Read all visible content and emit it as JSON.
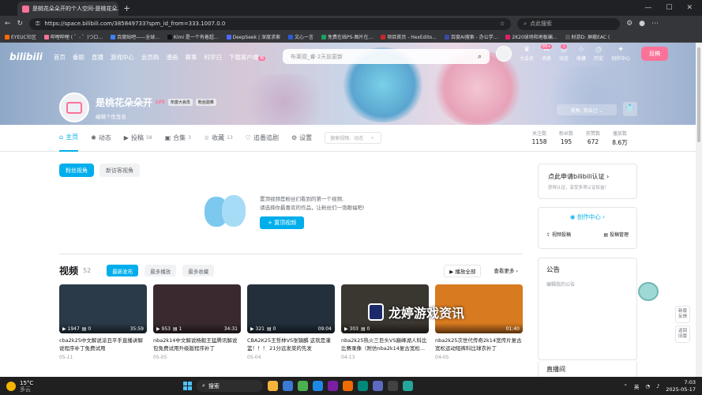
{
  "browser": {
    "tab_title": "是桃花朵朵开的个人空间-是桃花朵...",
    "url": "https://space.bilibili.com/385849733?spm_id_from=333.1007.0.0",
    "search_placeholder": "点此搜索",
    "bookmarks": [
      "EYEUC社区",
      "哔哩哔哩 ( ゜- ゜)つロ...",
      "百度贴吧——全球...",
      "Kimi 是一个有着超...",
      "DeepSeek | 深度求索",
      "文心一言",
      "免费在线PS-图片在...",
      "项目首页 - HexEdito...",
      "百度AI搜索 - 办公学...",
      "2K20球场和地板编...",
      "财游D: 屏蔽EAC ("
    ]
  },
  "topnav": {
    "logo": "bilibili",
    "links": [
      "首页",
      "番剧",
      "直播",
      "游戏中心",
      "会员购",
      "漫画",
      "赛事",
      "科学日",
      "下载客户端"
    ],
    "download_badge": "新",
    "search_placeholder": "布莱德_睿·2天前更新",
    "icons": [
      {
        "label": "大会员",
        "glyph": "♛"
      },
      {
        "label": "消息",
        "glyph": "✉",
        "badge": "99+"
      },
      {
        "label": "动态",
        "glyph": "◎",
        "badge": "1"
      },
      {
        "label": "收藏",
        "glyph": "☆"
      },
      {
        "label": "历史",
        "glyph": "◷"
      },
      {
        "label": "创作中心",
        "glyph": "✦"
      }
    ],
    "upload": "投稿"
  },
  "user": {
    "name": "是桃花朵朵开",
    "level": "LV5",
    "tag": "年度大会员",
    "follow_tag": "粉丝勋章",
    "sign": "编辑个性签名",
    "view_label": "视角: 我自己 ⌄"
  },
  "tabs": [
    {
      "label": "主页",
      "count": ""
    },
    {
      "label": "动态",
      "count": ""
    },
    {
      "label": "投稿",
      "count": "58"
    },
    {
      "label": "合集",
      "count": "3"
    },
    {
      "label": "收藏",
      "count": "13"
    },
    {
      "label": "追番追剧",
      "count": ""
    },
    {
      "label": "设置",
      "count": ""
    }
  ],
  "tab_search_placeholder": "搜索视频、动态",
  "stats": [
    {
      "label": "关注数",
      "value": "1158"
    },
    {
      "label": "粉丝数",
      "value": "195"
    },
    {
      "label": "获赞数",
      "value": "672"
    },
    {
      "label": "播放数",
      "value": "8.6万"
    }
  ],
  "view_tabs": [
    "粉丝视角",
    "新访客视角"
  ],
  "pinned": {
    "line1": "置顶视频是粉丝们看到的第一个视频,",
    "line2": "请选择你最喜欢的作品，让粉丝们一饱眼福吧!",
    "button": "+ 置顶视频"
  },
  "videos": {
    "title": "视频",
    "count": "52",
    "sort": [
      "最新发布",
      "最多播放",
      "最多收藏"
    ],
    "play_all": "▶ 播放全部",
    "more": "查看更多 ›",
    "items": [
      {
        "views": "1947",
        "comments": "0",
        "duration": "35:59",
        "title": "cba2k25中文解说涂丑平手直播讲解说程序补丁免费试用",
        "date": "05-11",
        "color": "#2a3a48"
      },
      {
        "views": "953",
        "comments": "1",
        "duration": "34:31",
        "title": "nba2k14中文解说杨毅王猛腾讯解说包免费试用升级版程序补丁",
        "date": "05-05",
        "color": "#3a2a30"
      },
      {
        "views": "321",
        "comments": "0",
        "duration": "09:04",
        "title": "CBA2K25王哲林VS张镇麟 这就是灌篮！！！ 21分远发菜的先发",
        "date": "05-04",
        "color": "#23303c"
      },
      {
        "views": "303",
        "comments": "0",
        "duration": "",
        "title": "nba2k25热火三巨头VS巅峰湖人科比 比赛录像（附仿nba2k14复古宽松...",
        "date": "04-13",
        "color": "#3a3630"
      },
      {
        "views": "",
        "comments": "",
        "duration": "01:40",
        "title": "nba2k25次世代传奇2k14宽传片复古宽松运动短裤科比球衣补丁",
        "date": "04-05",
        "color": "#d87a20"
      }
    ]
  },
  "side": {
    "apply_title": "点此申请bilibili认证 ›",
    "apply_desc": "获得认证，享受多项认证权益！",
    "creator": "创作中心 ›",
    "creator_links": [
      "视频投稿",
      "投稿管理"
    ],
    "notice_title": "公告",
    "notice_edit": "编辑我的公告",
    "live_title": "直播间"
  },
  "float_buttons": [
    "新版反馈",
    "返回旧版"
  ],
  "watermark": "龙婷游戏资讯",
  "taskbar": {
    "temp": "15°C",
    "weather": "多云",
    "search": "搜索",
    "lang": "英",
    "time": "7:03",
    "date": "2025-05-17"
  }
}
